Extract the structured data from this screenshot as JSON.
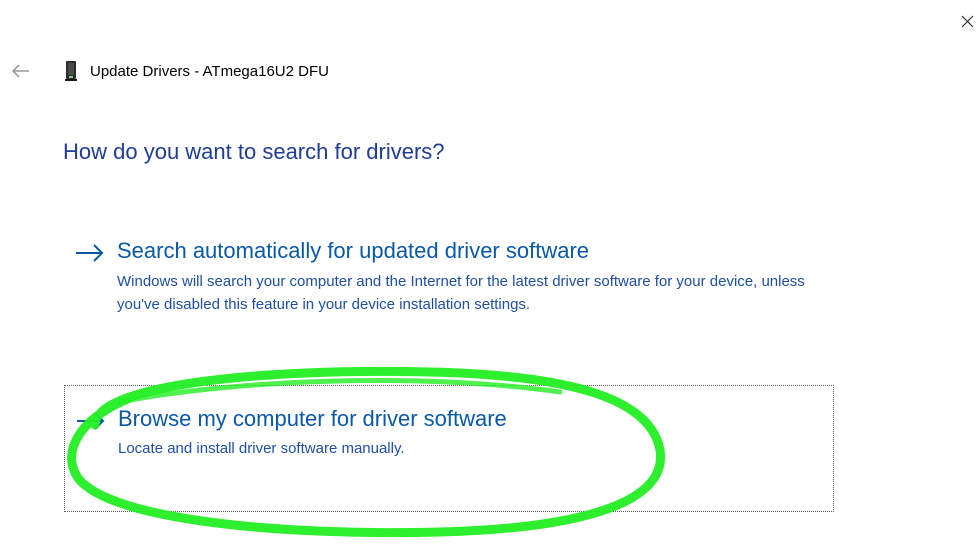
{
  "window": {
    "title": "Update Drivers - ATmega16U2 DFU",
    "close_icon": "close-icon",
    "back_icon": "back-arrow-icon",
    "device_icon": "usb-device-icon"
  },
  "heading": "How do you want to search for drivers?",
  "options": [
    {
      "icon": "arrow-right-icon",
      "title": "Search automatically for updated driver software",
      "description": "Windows will search your computer and the Internet for the latest driver software for your device, unless you've disabled this feature in your device installation settings."
    },
    {
      "icon": "arrow-right-icon",
      "title": "Browse my computer for driver software",
      "description": "Locate and install driver software manually.",
      "focused": true
    }
  ],
  "colors": {
    "heading": "#1f3c9a",
    "link": "#0a59a8",
    "description": "#1e4ea6",
    "highlight": "#22ee22"
  }
}
